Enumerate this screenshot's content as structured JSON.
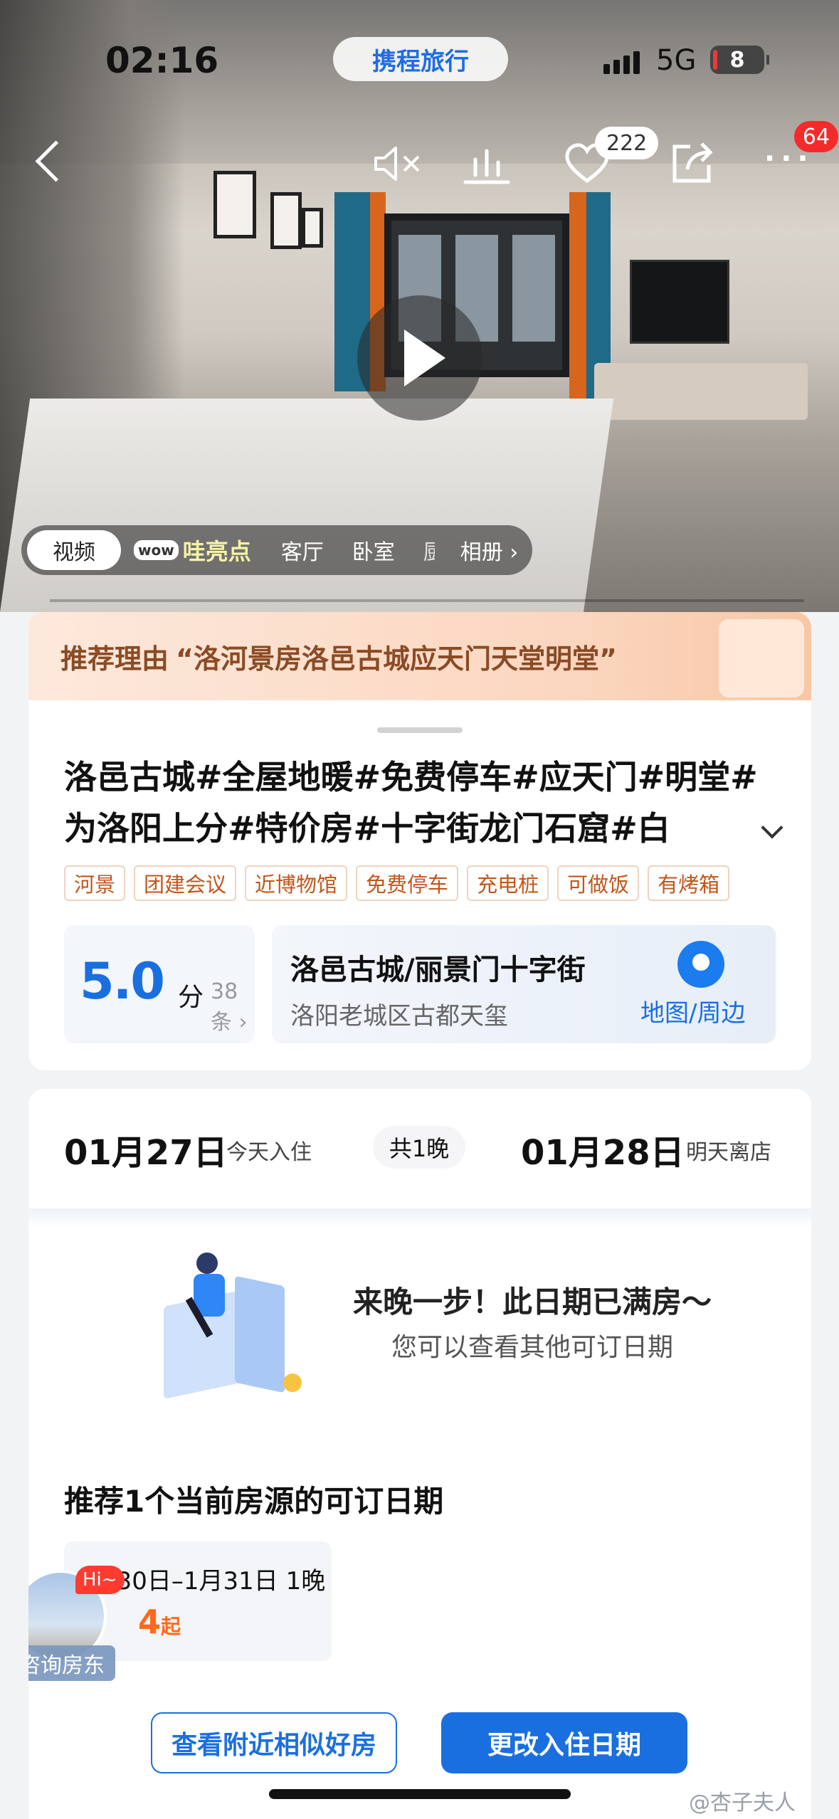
{
  "status": {
    "time": "02:16",
    "network": "5G",
    "battery": "8",
    "brand": "携程旅行"
  },
  "nav": {
    "back_icon": "chevron-left-icon",
    "mute_icon": "mute-icon",
    "like_count": "222",
    "menu_badge": "64"
  },
  "media_tabs": {
    "video": "视频",
    "wow": "哇亮点",
    "wow_prefix": "wow",
    "living_room": "客厅",
    "bedroom": "卧室",
    "partial": "厨",
    "album": "相册 ›"
  },
  "recommend": {
    "label": "推荐理由",
    "quote": "“洛河景房洛邑古城应天门天堂明堂”"
  },
  "listing": {
    "title": "洛邑古城#全屋地暖#免费停车#应天门#明堂#为洛阳上分#特价房#十字街龙门石窟#白",
    "tags": [
      "河景",
      "团建会议",
      "近博物馆",
      "免费停车",
      "充电桩",
      "可做饭",
      "有烤箱"
    ],
    "score": "5.0",
    "score_unit": "分",
    "review_count": "38条 ›",
    "location_name": "洛邑古城/丽景门十字街",
    "address": "洛阳老城区古都天玺",
    "map_label": "地图/周边"
  },
  "booking": {
    "checkin_date": "01月27日",
    "checkin_label": "今天入住",
    "nights": "共1晚",
    "checkout_date": "01月28日",
    "checkout_label": "明天离店",
    "full_title": "来晚一步！此日期已满房～",
    "full_sub": "您可以查看其他可订日期",
    "rec_title": "推荐1个当前房源的可订日期",
    "rec_date": "1月30日–1月31日 1晚",
    "rec_price": "4",
    "rec_price_suffix": "起",
    "host_hi": "Hi~",
    "host_label": "咨询房东",
    "btn_nearby": "查看附近相似好房",
    "btn_change": "更改入住日期"
  },
  "watermark": "@杏子夫人",
  "colors": {
    "accent": "#1a6fe0",
    "price": "#ff6a1a",
    "tag": "#c2561b",
    "badge": "#f52b2b"
  }
}
